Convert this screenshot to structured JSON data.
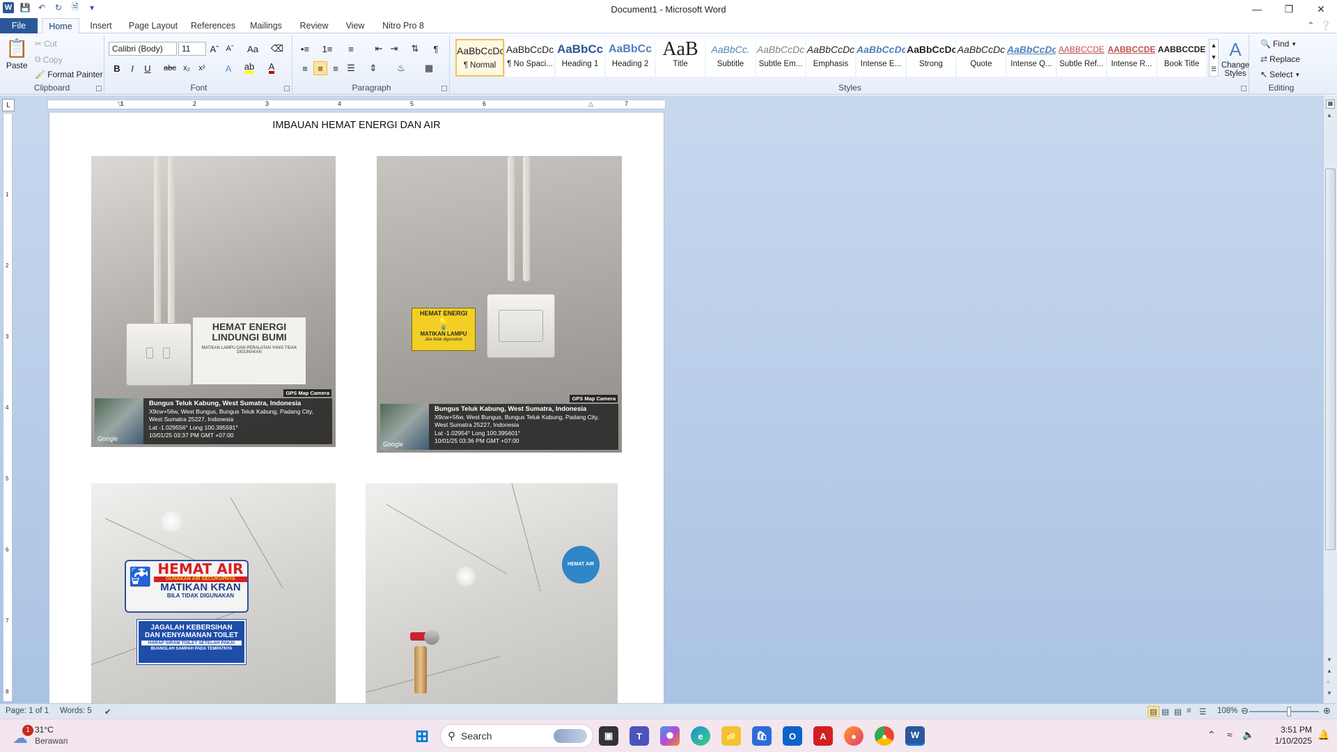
{
  "window": {
    "title": "Document1 - Microsoft Word",
    "minimize_icon": "minimize-icon",
    "restore_icon": "restore-icon",
    "close_icon": "close-icon"
  },
  "tabs": [
    "File",
    "Home",
    "Insert",
    "Page Layout",
    "References",
    "Mailings",
    "Review",
    "View",
    "Nitro Pro 8"
  ],
  "ribbon": {
    "clipboard": {
      "label": "Clipboard",
      "paste": "Paste",
      "cut": "Cut",
      "copy": "Copy",
      "format_painter": "Format Painter"
    },
    "font": {
      "label": "Font",
      "font_name": "Calibri (Body)",
      "font_size": "11",
      "bold": "B",
      "italic": "I",
      "underline": "U",
      "strike": "abc",
      "font_color": "#c00000",
      "highlight_color": "#ffff00",
      "change_case": "Aa"
    },
    "paragraph": {
      "label": "Paragraph"
    },
    "styles": {
      "label": "Styles",
      "items": [
        {
          "preview": "AaBbCcDc",
          "name": "¶ Normal"
        },
        {
          "preview": "AaBbCcDc",
          "name": "¶ No Spaci..."
        },
        {
          "preview": "AaBbCc",
          "name": "Heading 1"
        },
        {
          "preview": "AaBbCc",
          "name": "Heading 2"
        },
        {
          "preview": "AaB",
          "name": "Title"
        },
        {
          "preview": "AaBbCc.",
          "name": "Subtitle"
        },
        {
          "preview": "AaBbCcDc",
          "name": "Subtle Em..."
        },
        {
          "preview": "AaBbCcDc",
          "name": "Emphasis"
        },
        {
          "preview": "AaBbCcDc",
          "name": "Intense E..."
        },
        {
          "preview": "AaBbCcDc",
          "name": "Strong"
        },
        {
          "preview": "AaBbCcDc",
          "name": "Quote"
        },
        {
          "preview": "AaBbCcDc",
          "name": "Intense Q..."
        },
        {
          "preview": "AABBCCDE",
          "name": "Subtle Ref..."
        },
        {
          "preview": "AABBCCDE",
          "name": "Intense R..."
        },
        {
          "preview": "AABBCCDE",
          "name": "Book Title"
        }
      ],
      "change_styles": "Change Styles"
    },
    "editing": {
      "label": "Editing",
      "find": "Find",
      "replace": "Replace",
      "select": "Select"
    }
  },
  "ruler_numbers": [
    "1",
    "1",
    "2",
    "3",
    "4",
    "5",
    "6",
    "7"
  ],
  "vruler_numbers": [
    "1",
    "2",
    "3",
    "4",
    "5",
    "6",
    "7",
    "8"
  ],
  "document": {
    "heading": "IMBAUAN HEMAT ENERGI DAN AIR",
    "photos": [
      {
        "sticker_line1": "HEMAT ENERGI",
        "sticker_line2": "LINDUNGI BUMI",
        "sticker_line3": "MATIKAN LAMPU DAN PERALATAN YANG TIDAK DIGUNAKAN",
        "gps_cam": "GPS Map Camera",
        "google": "Google",
        "line1": "Bungus Teluk Kabung, West Sumatra, Indonesia",
        "line2": "X9cw+56w, West Bungus, Bungus Teluk Kabung, Padang City,",
        "line3": "West Sumatra 25227, Indonesia",
        "line4": "Lat -1.029556° Long 100.395591°",
        "line5": "10/01/25 03:37 PM GMT +07:00"
      },
      {
        "sticker_line1": "HEMAT ENERGI",
        "sticker_line2": "MATIKAN LAMPU",
        "sticker_line3": "Jika tidak digunakan",
        "gps_cam": "GPS Map Camera",
        "google": "Google",
        "line1": "Bungus Teluk Kabung, West Sumatra, Indonesia",
        "line2": "X9cw+56w, West Bungus, Bungus Teluk Kabung, Padang City,",
        "line3": "West Sumatra 25227, Indonesia",
        "line4": "Lat -1.02954° Long 100.395601°",
        "line5": "10/01/25 03:36 PM GMT +07:00"
      },
      {
        "sticker_line1": "HEMAT AIR",
        "sticker_line2": "GUNAKAN AIR SECUKUPNYA",
        "sticker_line3": "MATIKAN KRAN",
        "sticker_line4": "BILA TIDAK DIGUNAKAN",
        "sign_line1": "JAGALAH KEBERSIHAN",
        "sign_line2": "DAN KENYAMANAN TOILET",
        "sign_line3": "HARAP SIRAM TOILET SETELAH PAKAI",
        "sign_line4": "BUANGLAH SAMPAH PADA TEMPATNYA"
      },
      {
        "sticker_round": "HEMAT AIR"
      }
    ]
  },
  "status": {
    "page": "Page: 1 of 1",
    "words": "Words: 5",
    "zoom": "108%"
  },
  "taskbar": {
    "weather_temp": "31°C",
    "weather_desc": "Berawan",
    "weather_badge": "1",
    "search_placeholder": "Search",
    "time": "3:51 PM",
    "date": "1/10/2025"
  }
}
